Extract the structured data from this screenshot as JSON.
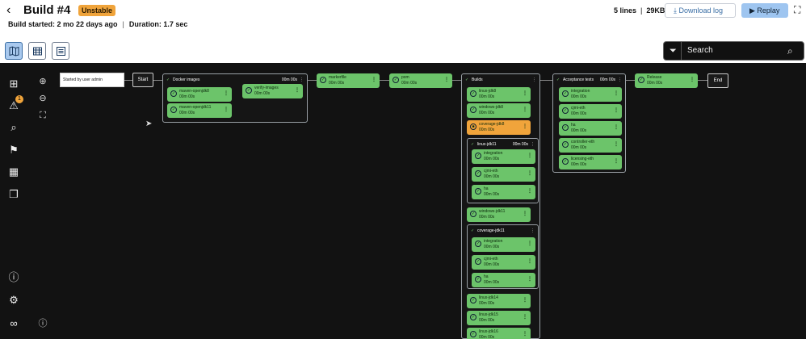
{
  "header": {
    "back_icon": "chevron-left-icon",
    "title": "Build #4",
    "chevron": "›",
    "status": "Unstable",
    "started": "Build started: 2 mo 22 days ago",
    "duration": "Duration: 1.7 sec",
    "lines": "5 lines",
    "size": "29KB",
    "download": "Download log",
    "replay": "Replay"
  },
  "search": {
    "placeholder": "Search"
  },
  "sidebar": {
    "warning_count": "1"
  },
  "pipeline": {
    "start_trigger": "Started by user admin",
    "start": "Start",
    "end": "End",
    "docker": {
      "name": "Docker images",
      "dur": "00m 00s",
      "items": [
        "maven-openjdk8",
        "maven-openjdk11"
      ],
      "verify": "verify-images"
    },
    "markerfile": "markerfile",
    "pom": "pom",
    "builds": {
      "name": "Builds",
      "items": [
        "linux-jdk8",
        "windows-jdk8"
      ],
      "unstable": "coverage-jdk8",
      "linux11": {
        "name": "linux-jdk11",
        "dur": "00m 00s",
        "items": [
          "integration",
          "cjmi-eth",
          "ha"
        ]
      },
      "windows11": "windows-jdk11",
      "coverage11": {
        "name": "coverage-jdk11",
        "items": [
          "integration",
          "cjmi-eth",
          "ha"
        ]
      },
      "tail": [
        "linux-jdk14",
        "linux-jdk15",
        "linux-jdk16"
      ]
    },
    "acceptance": {
      "name": "Acceptance tests",
      "dur": "00m 00s",
      "items": [
        "integration",
        "cjmi-eth",
        "ha",
        "controller-eth",
        "licensing-eth"
      ]
    },
    "release": "Release",
    "dur": "00m 00s",
    "dur_short": "00m 00s"
  }
}
